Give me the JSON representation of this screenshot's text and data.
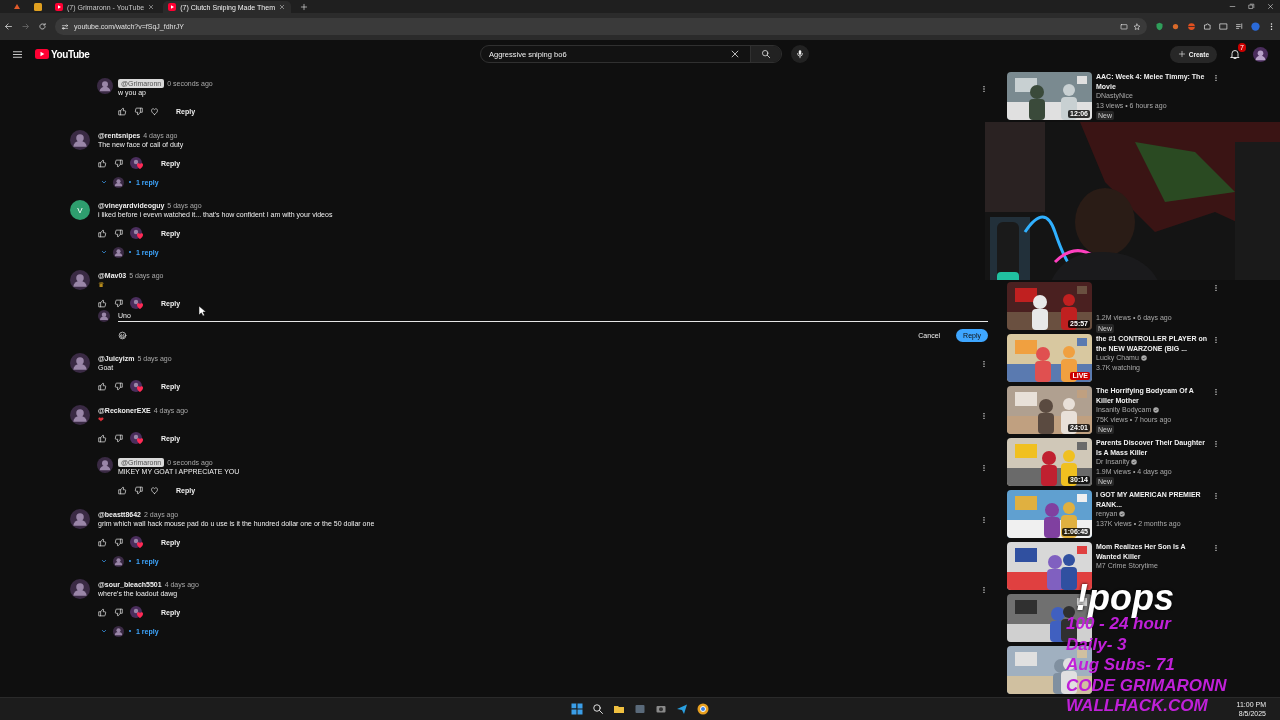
{
  "browser": {
    "tabs": [
      {
        "kind": "icon",
        "selected": false
      },
      {
        "kind": "icon",
        "selected": false
      },
      {
        "kind": "page",
        "title": "(7) Grimaronn - YouTube",
        "selected": false
      },
      {
        "kind": "page",
        "title": "(7) Clutch Sniping Made Them",
        "selected": true
      }
    ],
    "url": "youtube.com/watch?v=fSqJ_fdhrJY"
  },
  "masthead": {
    "logo": "YouTube",
    "search": "Aggressive sniping bo6",
    "create": "Create",
    "notifications": "7"
  },
  "comments": [
    {
      "kind": "reply",
      "author": "@Grimaronn",
      "creator": true,
      "time": "0 seconds ago",
      "text": "w you ap",
      "hearted": false,
      "reply": "Reply",
      "menu": true
    },
    {
      "kind": "comment",
      "author": "@rentsnipes",
      "creator": false,
      "time": "4 days ago",
      "text": "The new face of call of duty",
      "hearted": true,
      "reply": "Reply",
      "replies": "1 reply",
      "menu": false
    },
    {
      "kind": "comment",
      "author": "@vineyardvideoguy",
      "avatar": "V",
      "creator": false,
      "time": "5 days ago",
      "text": "i liked before i evevn watched it... that's how confident I am with your videos",
      "hearted": true,
      "reply": "Reply",
      "replies": "1 reply",
      "menu": false
    },
    {
      "kind": "comment",
      "author": "@Mav03",
      "creator": false,
      "time": "5 days ago",
      "text": "♛",
      "hearted": true,
      "reply": "Reply",
      "menu": false,
      "reply_box": {
        "value": "Uno",
        "buttons": [
          {
            "label": "Cancel",
            "kind": "text"
          },
          {
            "label": "Reply",
            "kind": "primary"
          }
        ]
      }
    },
    {
      "kind": "comment",
      "author": "@Juicyizm",
      "creator": false,
      "time": "5 days ago",
      "text": "Goat",
      "hearted": true,
      "reply": "Reply",
      "menu": true
    },
    {
      "kind": "comment",
      "author": "@ReckonerEXE",
      "creator": false,
      "time": "4 days ago",
      "text": "❤",
      "hearted": true,
      "reply": "Reply",
      "menu": true
    },
    {
      "kind": "reply",
      "author": "@Grimaronn",
      "creator": true,
      "time": "0 seconds ago",
      "text": "MIKEY MY GOAT I APPRECIATE YOU",
      "hearted": false,
      "reply": "Reply",
      "menu": true
    },
    {
      "kind": "comment",
      "author": "@beastt8642",
      "creator": false,
      "time": "2 days ago",
      "text": "grim which wall hack mouse pad do u use is it the hundred dollar one or the 50 dollar one",
      "hearted": true,
      "reply": "Reply",
      "replies": "1 reply",
      "menu": true
    },
    {
      "kind": "comment",
      "author": "@sour_bleach5501",
      "creator": false,
      "time": "4 days ago",
      "text": "where's the loadout dawg",
      "hearted": true,
      "reply": "Reply",
      "replies": "1 reply",
      "menu": true
    }
  ],
  "related": [
    {
      "kind": "video",
      "title": "AAC: Week 4: Melee Timmy: The Movie",
      "channel": "DNastyNice",
      "verified": false,
      "meta": "13 views • 6 hours ago",
      "badge": "New",
      "duration": "12:06"
    },
    {
      "kind": "video",
      "meta": "1.2M views • 6 days ago",
      "badge": "New",
      "duration": "25:57"
    },
    {
      "kind": "video",
      "title": "the #1 CONTROLLER PLAYER on the NEW WARZONE (BIG ...",
      "channel": "Lucky Chamu",
      "verified": true,
      "meta": "3.7K watching",
      "live": "LIVE"
    },
    {
      "kind": "video",
      "title": "The Horrifying Bodycam Of A Killer Mother",
      "channel": "Insanity Bodycam",
      "verified": true,
      "meta": "75K views • 7 hours ago",
      "badge": "New",
      "duration": "24:01"
    },
    {
      "kind": "video",
      "title": "Parents Discover Their Daughter Is A Mass Killer",
      "channel": "Dr Insanity",
      "verified": true,
      "meta": "1.9M views • 4 days ago",
      "badge": "New",
      "duration": "30:14"
    },
    {
      "kind": "video",
      "title": "I GOT MY AMERICAN PREMIER RANK...",
      "channel": "renyan",
      "verified": true,
      "meta": "137K views • 2 months ago",
      "duration": "1:06:45"
    },
    {
      "kind": "video",
      "title": "Mom Realizes Her Son Is A Wanted Killer",
      "channel": "M7 Crime Storytime",
      "verified": false
    },
    {
      "kind": "thumbnail"
    },
    {
      "kind": "thumbnail"
    }
  ],
  "overlay": {
    "command": "!pops",
    "lines": [
      "100 - 24 hour",
      "Daily- 3",
      "Aug Subs- 71",
      "CODE GRIMARONN",
      "WALLHACK.COM"
    ]
  },
  "taskbar": {
    "time": "11:00 PM",
    "date": "8/5/2025"
  }
}
